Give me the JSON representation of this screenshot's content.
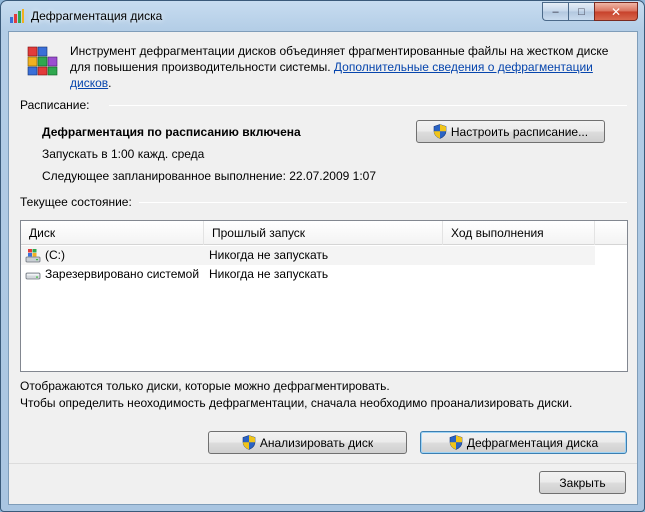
{
  "window": {
    "title": "Дефрагментация диска",
    "caption": {
      "minimize": "–",
      "maximize": "□",
      "close": "✕"
    }
  },
  "intro": {
    "text": "Инструмент дефрагментации дисков объединяет фрагментированные файлы на жестком диске для повышения производительности системы. ",
    "link": "Дополнительные сведения о дефрагментации дисков",
    "tail": "."
  },
  "schedule": {
    "group_label": "Расписание:",
    "title": "Дефрагментация по расписанию включена",
    "run": "Запускать в 1:00 кажд. среда",
    "next": "Следующее запланированное выполнение: 22.07.2009 1:07",
    "configure_button": "Настроить расписание..."
  },
  "status": {
    "group_label": "Текущее состояние:",
    "columns": [
      "Диск",
      "Прошлый запуск",
      "Ход выполнения"
    ],
    "rows": [
      {
        "disk": "(C:)",
        "last_run": "Никогда не запускать",
        "progress": "",
        "icon": "windows-drive-icon"
      },
      {
        "disk": "Зарезервировано системой",
        "last_run": "Никогда не запускать",
        "progress": "",
        "icon": "hard-drive-icon"
      }
    ]
  },
  "notes": {
    "line1": "Отображаются только диски, которые можно дефрагментировать.",
    "line2": "Чтобы определить неоходимость  дефрагментации, сначала необходимо проанализировать диски."
  },
  "actions": {
    "analyze": "Анализировать диск",
    "defrag": "Дефрагментация диска",
    "close": "Закрыть"
  }
}
